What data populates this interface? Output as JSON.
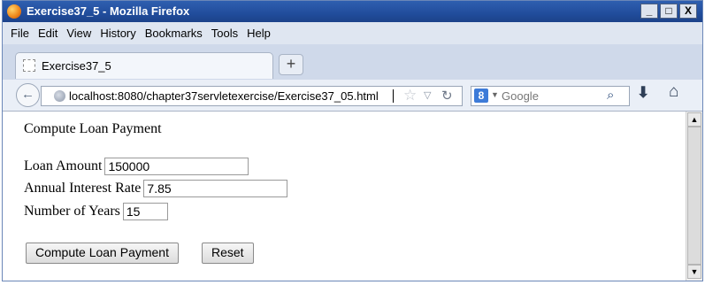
{
  "window": {
    "title": "Exercise37_5 - Mozilla Firefox",
    "controls": {
      "minimize": "_",
      "maximize": "□",
      "close": "X"
    }
  },
  "menubar": {
    "items": [
      {
        "label": "File"
      },
      {
        "label": "Edit"
      },
      {
        "label": "View"
      },
      {
        "label": "History"
      },
      {
        "label": "Bookmarks"
      },
      {
        "label": "Tools"
      },
      {
        "label": "Help"
      }
    ]
  },
  "tabs": {
    "items": [
      {
        "label": "Exercise37_5"
      }
    ],
    "new_tab_label": "+"
  },
  "navbar": {
    "url": "localhost:8080/chapter37servletexercise/Exercise37_05.html",
    "search_engine": "8",
    "search_placeholder": "Google"
  },
  "page": {
    "heading": "Compute Loan Payment",
    "fields": [
      {
        "label": "Loan Amount",
        "value": "150000"
      },
      {
        "label": "Annual Interest Rate",
        "value": "7.85"
      },
      {
        "label": "Number of Years",
        "value": "15"
      }
    ],
    "buttons": {
      "compute": "Compute Loan Payment",
      "reset": "Reset"
    }
  },
  "icons": {
    "back": "back-arrow-icon",
    "globe": "globe-icon",
    "bookmark_star": "star-icon",
    "reload": "reload-icon",
    "search": "search-icon",
    "download": "download-icon",
    "home": "home-icon"
  },
  "colors": {
    "titlebar": "#214d9c",
    "title_text": "#ffffff",
    "menubar": "#dfe6f1",
    "content_bg": "#ffffff"
  }
}
